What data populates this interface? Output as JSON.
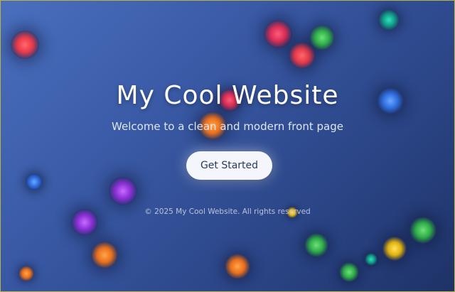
{
  "hero": {
    "title": "My Cool Website",
    "subtitle": "Welcome to a clean and modern front page",
    "cta_label": "Get Started"
  },
  "footer": {
    "copyright": "© 2025 My Cool Website. All rights reserved"
  },
  "colors": {
    "background_start": "#4a6fbe",
    "background_end": "#1e3266",
    "title": "#ffffff",
    "button_bg": "#f4f6fb",
    "button_text": "#2a3a5c"
  },
  "decoration": {
    "orb_colors": [
      "red",
      "green",
      "teal",
      "blue",
      "orange",
      "purple",
      "yellow",
      "pink"
    ]
  }
}
